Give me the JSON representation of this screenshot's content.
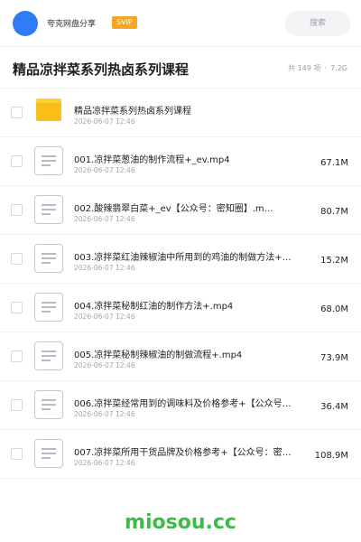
{
  "header": {
    "username": "夸克网盘分享",
    "badge": "SVIP",
    "search_placeholder": "搜索"
  },
  "folder": {
    "title": "精品凉拌菜系列热卤系列课程",
    "count_text": "共 149 项",
    "separator": "·",
    "size_text": "7.2G"
  },
  "files": [
    {
      "type": "folder",
      "name": "精品凉拌菜系列热卤系列课程",
      "date": "2026-06-07 12:46",
      "size": ""
    },
    {
      "type": "file",
      "name": "001.凉拌菜葱油的制作流程+_ev.mp4",
      "date": "2026-06-07 12:46",
      "size": "67.1M"
    },
    {
      "type": "file",
      "name": "002.酸辣翡翠白菜+_ev【公众号：密知圈】.m…",
      "date": "2026-06-07 12:46",
      "size": "80.7M"
    },
    {
      "type": "file",
      "name": "003.凉拌菜红油辣椒油中所用到的鸡油的制做方法+…",
      "date": "2026-06-07 12:46",
      "size": "15.2M"
    },
    {
      "type": "file",
      "name": "004.凉拌菜秘制红油的制作方法+.mp4",
      "date": "2026-06-07 12:46",
      "size": "68.0M"
    },
    {
      "type": "file",
      "name": "005.凉拌菜秘制辣椒油的制做流程+.mp4",
      "date": "2026-06-07 12:46",
      "size": "73.9M"
    },
    {
      "type": "file",
      "name": "006.凉拌菜经常用到的调味料及价格参考+【公众号…",
      "date": "2026-06-07 12:46",
      "size": "36.4M"
    },
    {
      "type": "file",
      "name": "007.凉拌菜所用干货品牌及价格参考+【公众号：密…",
      "date": "2026-06-07 12:46",
      "size": "108.9M"
    }
  ],
  "watermark": "miosou.cc",
  "colors": {
    "accent": "#2f7cf6",
    "svip": "#f6a623",
    "folder": "#fbbd18",
    "watermark": "#3dbb49"
  }
}
